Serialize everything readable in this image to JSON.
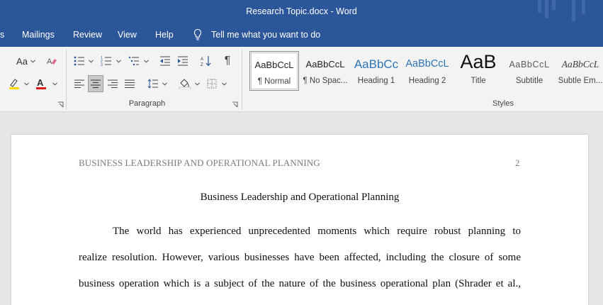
{
  "window": {
    "title": "Research Topic.docx  -  Word"
  },
  "menu": {
    "items": [
      "s",
      "Mailings",
      "Review",
      "View",
      "Help"
    ],
    "tell_me": "Tell me what you want to do"
  },
  "ribbon": {
    "groups": {
      "paragraph": "Paragraph",
      "styles": "Styles"
    },
    "font": {
      "case_label": "Aa"
    },
    "colors": {
      "highlight": "#ffd800",
      "font_color": "#d81e1e"
    }
  },
  "styles": [
    {
      "sample": "AaBbCcL",
      "name": "¶ Normal",
      "selected": true
    },
    {
      "sample": "AaBbCcL",
      "name": "¶ No Spac..."
    },
    {
      "sample": "AaBbCc",
      "name": "Heading 1"
    },
    {
      "sample": "AaBbCcL",
      "name": "Heading 2"
    },
    {
      "sample": "AaB",
      "name": "Title"
    },
    {
      "sample": "AaBbCcL",
      "name": "Subtitle"
    },
    {
      "sample": "AaBbCcL",
      "name": "Subtle Em..."
    }
  ],
  "document": {
    "running_head": "BUSINESS LEADERSHIP AND OPERATIONAL PLANNING",
    "page_number": "2",
    "title": "Business Leadership and Operational Planning",
    "lines": [
      "The world has experienced unprecedented moments which require robust planning to",
      "realize resolution. However, various businesses have been affected, including the closure of some",
      "business operation which is a subject of the nature of the business operational plan (Shrader et al.,"
    ]
  }
}
